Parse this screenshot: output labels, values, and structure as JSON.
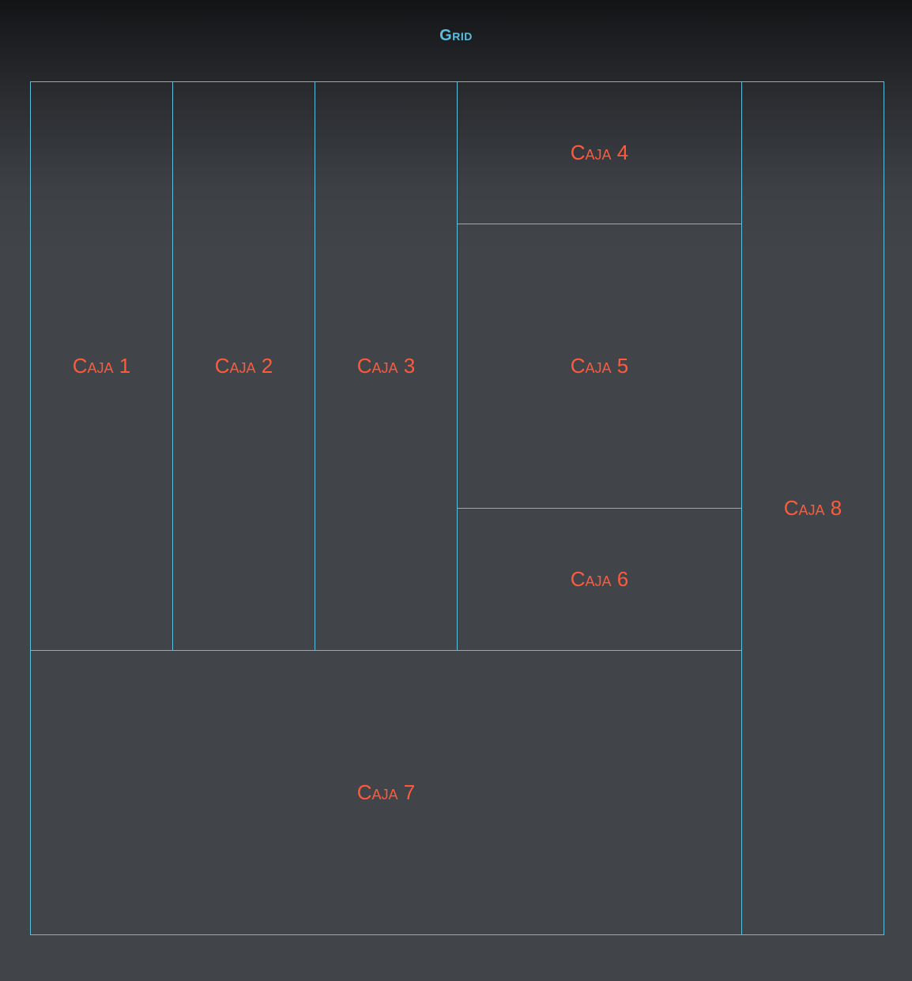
{
  "title": "Grid",
  "colors": {
    "accent": "#5bc0de",
    "label": "#ff5a3c",
    "background": "#414448"
  },
  "boxes": [
    {
      "label": "Caja 1"
    },
    {
      "label": "Caja 2"
    },
    {
      "label": "Caja 3"
    },
    {
      "label": "Caja 4"
    },
    {
      "label": "Caja 5"
    },
    {
      "label": "Caja 6"
    },
    {
      "label": "Caja 7"
    },
    {
      "label": "Caja 8"
    }
  ]
}
